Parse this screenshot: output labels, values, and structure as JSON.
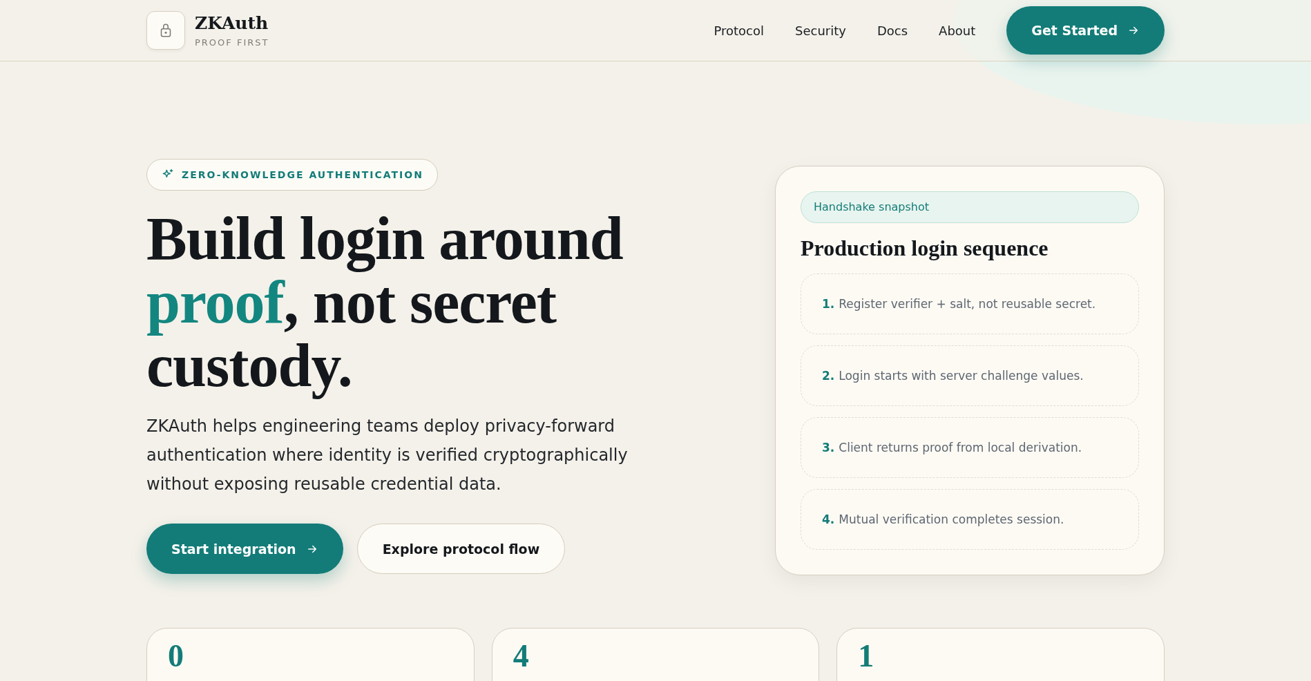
{
  "header": {
    "brand": "ZKAuth",
    "tagline": "PROOF FIRST",
    "nav": [
      "Protocol",
      "Security",
      "Docs",
      "About"
    ],
    "cta": "Get Started"
  },
  "hero": {
    "badge": "ZERO-KNOWLEDGE AUTHENTICATION",
    "headline": [
      {
        "text": "Build login around ",
        "accent": false
      },
      {
        "text": "proof",
        "accent": true
      },
      {
        "text": ", not secret custody.",
        "accent": false
      }
    ],
    "description": "ZKAuth helps engineering teams deploy privacy-forward authentication where identity is verified cryptographically without exposing reusable credential data.",
    "buttons": [
      {
        "label": "Start integration",
        "kind": "primary"
      },
      {
        "label": "Explore protocol flow",
        "kind": "secondary"
      }
    ]
  },
  "snapshot": {
    "chip": "Handshake snapshot",
    "title": "Production login sequence",
    "steps": [
      {
        "number": "1.",
        "text": "Register verifier + salt, not reusable secret."
      },
      {
        "number": "2.",
        "text": "Login starts with server challenge values."
      },
      {
        "number": "3.",
        "text": "Client returns proof from local derivation."
      },
      {
        "number": "4.",
        "text": "Mutual verification completes session."
      }
    ]
  },
  "stats": [
    {
      "value": "0"
    },
    {
      "value": "4"
    },
    {
      "value": "1"
    }
  ]
}
